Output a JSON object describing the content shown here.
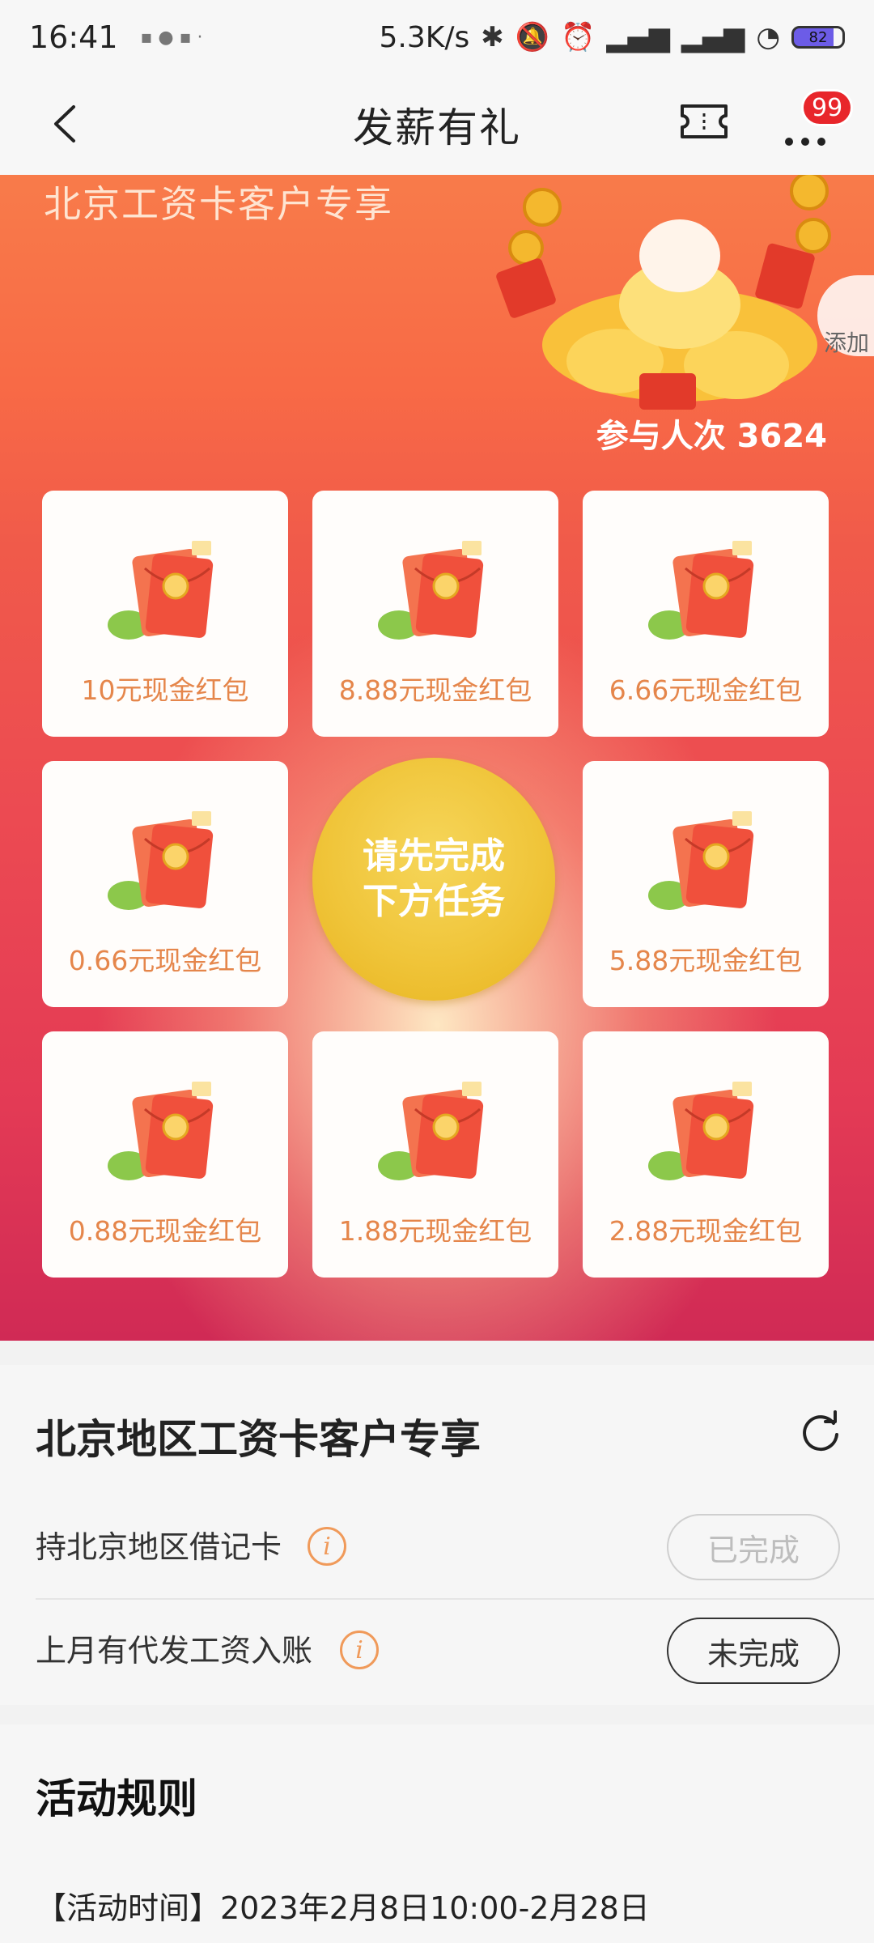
{
  "status_bar": {
    "time": "16:41",
    "speed": "5.3K/s",
    "battery": "82",
    "icons": [
      "notification-icon",
      "bluetooth-icon",
      "mute-icon",
      "alarm-icon",
      "signal-hd-icon",
      "signal-hd-icon",
      "wifi-icon",
      "battery-icon"
    ]
  },
  "nav": {
    "title": "发薪有礼",
    "badge": "99"
  },
  "banner": {
    "title": "北京工资卡客户专享",
    "side_tab_label": "添加",
    "participants_label": "参与人次 3624",
    "prizes": [
      "10元现金红包",
      "8.88元现金红包",
      "6.66元现金红包",
      "0.66元现金红包",
      "5.88元现金红包",
      "0.88元现金红包",
      "1.88元现金红包",
      "2.88元现金红包"
    ],
    "center_button": [
      "请先完成",
      "下方任务"
    ]
  },
  "tasks": {
    "title": "北京地区工资卡客户专享",
    "items": [
      {
        "label": "持北京地区借记卡",
        "status": "已完成"
      },
      {
        "label": "上月有代发工资入账",
        "status": "未完成"
      }
    ]
  },
  "rules": {
    "title": "活动规则",
    "time_text": "【活动时间】2023年2月8日10:00-2月28日"
  },
  "colors": {
    "accent_orange": "#e5864b",
    "badge_red": "#e8262b",
    "center_gold": "#f0c53a"
  }
}
